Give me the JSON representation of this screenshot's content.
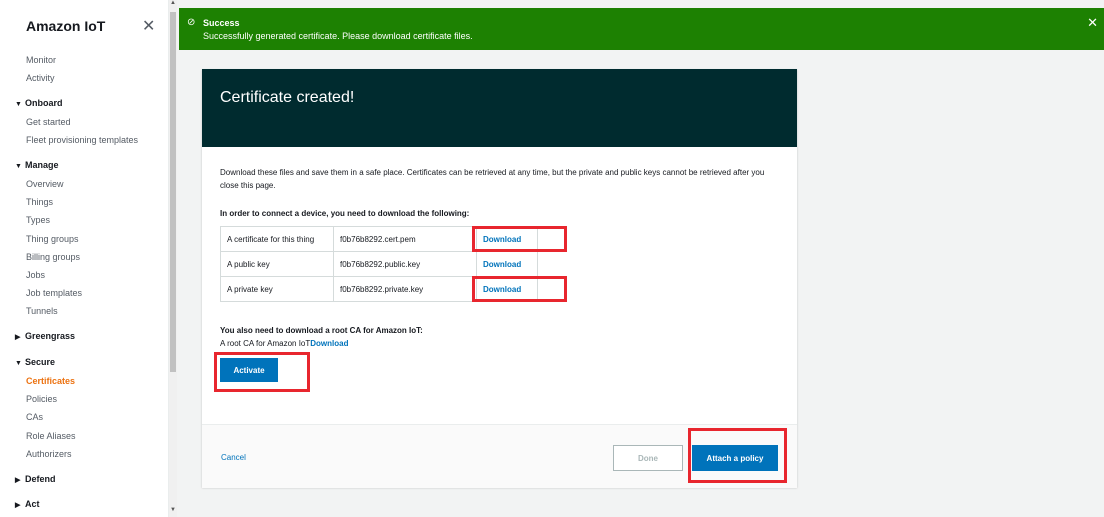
{
  "sidebar": {
    "title": "Amazon IoT",
    "close_icon": "close-icon",
    "top_items": [
      "Monitor",
      "Activity"
    ],
    "sections": [
      {
        "label": "Onboard",
        "expanded": true,
        "items": [
          "Get started",
          "Fleet provisioning templates"
        ]
      },
      {
        "label": "Manage",
        "expanded": true,
        "items": [
          "Overview",
          "Things",
          "Types",
          "Thing groups",
          "Billing groups",
          "Jobs",
          "Job templates",
          "Tunnels"
        ]
      },
      {
        "label": "Greengrass",
        "expanded": false,
        "items": []
      },
      {
        "label": "Secure",
        "expanded": true,
        "items": [
          "Certificates",
          "Policies",
          "CAs",
          "Role Aliases",
          "Authorizers"
        ]
      },
      {
        "label": "Defend",
        "expanded": false,
        "items": []
      },
      {
        "label": "Act",
        "expanded": false,
        "items": []
      }
    ],
    "active_item": "Certificates"
  },
  "flash": {
    "title": "Success",
    "message": "Successfully generated certificate. Please download certificate files.",
    "close": "✕",
    "color": "#1d8102"
  },
  "card": {
    "title": "Certificate created!",
    "description": "Download these files and save them in a safe place. Certificates can be retrieved at any time, but the private and public keys cannot be retrieved after you close this page.",
    "connect_heading": "In order to connect a device, you need to download the following:",
    "files": [
      {
        "label": "A certificate for this thing",
        "filename": "f0b76b8292.cert.pem",
        "action": "Download"
      },
      {
        "label": "A public key",
        "filename": "f0b76b8292.public.key",
        "action": "Download"
      },
      {
        "label": "A private key",
        "filename": "f0b76b8292.private.key",
        "action": "Download"
      }
    ],
    "root_ca_heading": "You also need to download a root CA for Amazon IoT:",
    "root_ca_label": "A root CA for Amazon IoT",
    "root_ca_link": "Download",
    "activate_label": "Activate",
    "cancel_label": "Cancel",
    "done_label": "Done",
    "attach_label": "Attach a policy"
  },
  "colors": {
    "header_bg": "#002b2f",
    "primary": "#0073bb",
    "active_nav": "#ec7211",
    "highlight": "#e8262e"
  }
}
